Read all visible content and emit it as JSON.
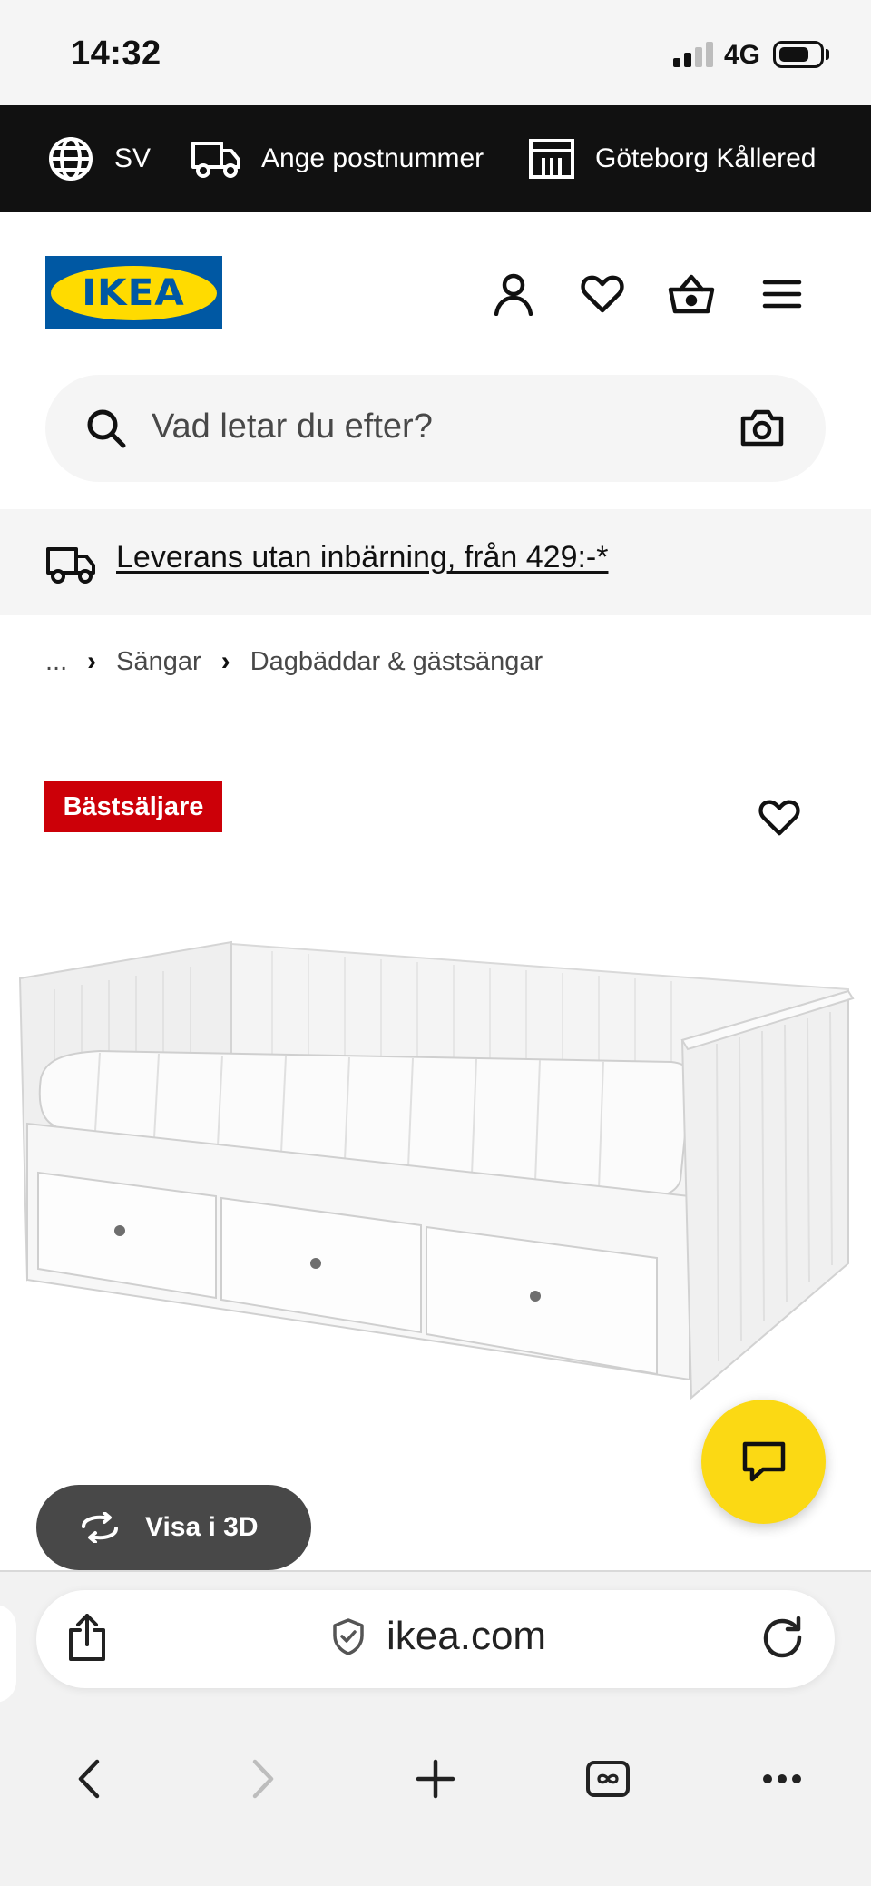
{
  "status_bar": {
    "time": "14:32",
    "network": "4G"
  },
  "top_bar": {
    "language": "SV",
    "postcode": "Ange postnummer",
    "store": "Göteborg Kållered"
  },
  "header": {
    "logo": "IKEA"
  },
  "search": {
    "placeholder": "Vad letar du efter?"
  },
  "delivery": {
    "text": "Leverans utan inbärning, från 429:-*"
  },
  "breadcrumb": {
    "ellipsis": "...",
    "items": [
      "Sängar",
      "Dagbäddar & gästsängar"
    ]
  },
  "product": {
    "badge": "Bästsäljare",
    "badge_color": "#cc0008"
  },
  "view3d": {
    "label": "Visa i 3D"
  },
  "browser": {
    "url": "ikea.com"
  },
  "colors": {
    "brand_blue": "#0058a3",
    "brand_yellow": "#ffdb00",
    "chat_yellow": "#fbd914"
  },
  "icons": [
    "globe-icon",
    "truck-icon",
    "store-icon",
    "user-icon",
    "heart-icon",
    "basket-icon",
    "menu-icon",
    "search-icon",
    "camera-icon",
    "chat-icon",
    "rotate-3d-icon",
    "share-icon",
    "shield-icon",
    "reload-icon",
    "back-icon",
    "forward-icon",
    "new-tab-icon",
    "tabs-icon",
    "more-icon"
  ]
}
